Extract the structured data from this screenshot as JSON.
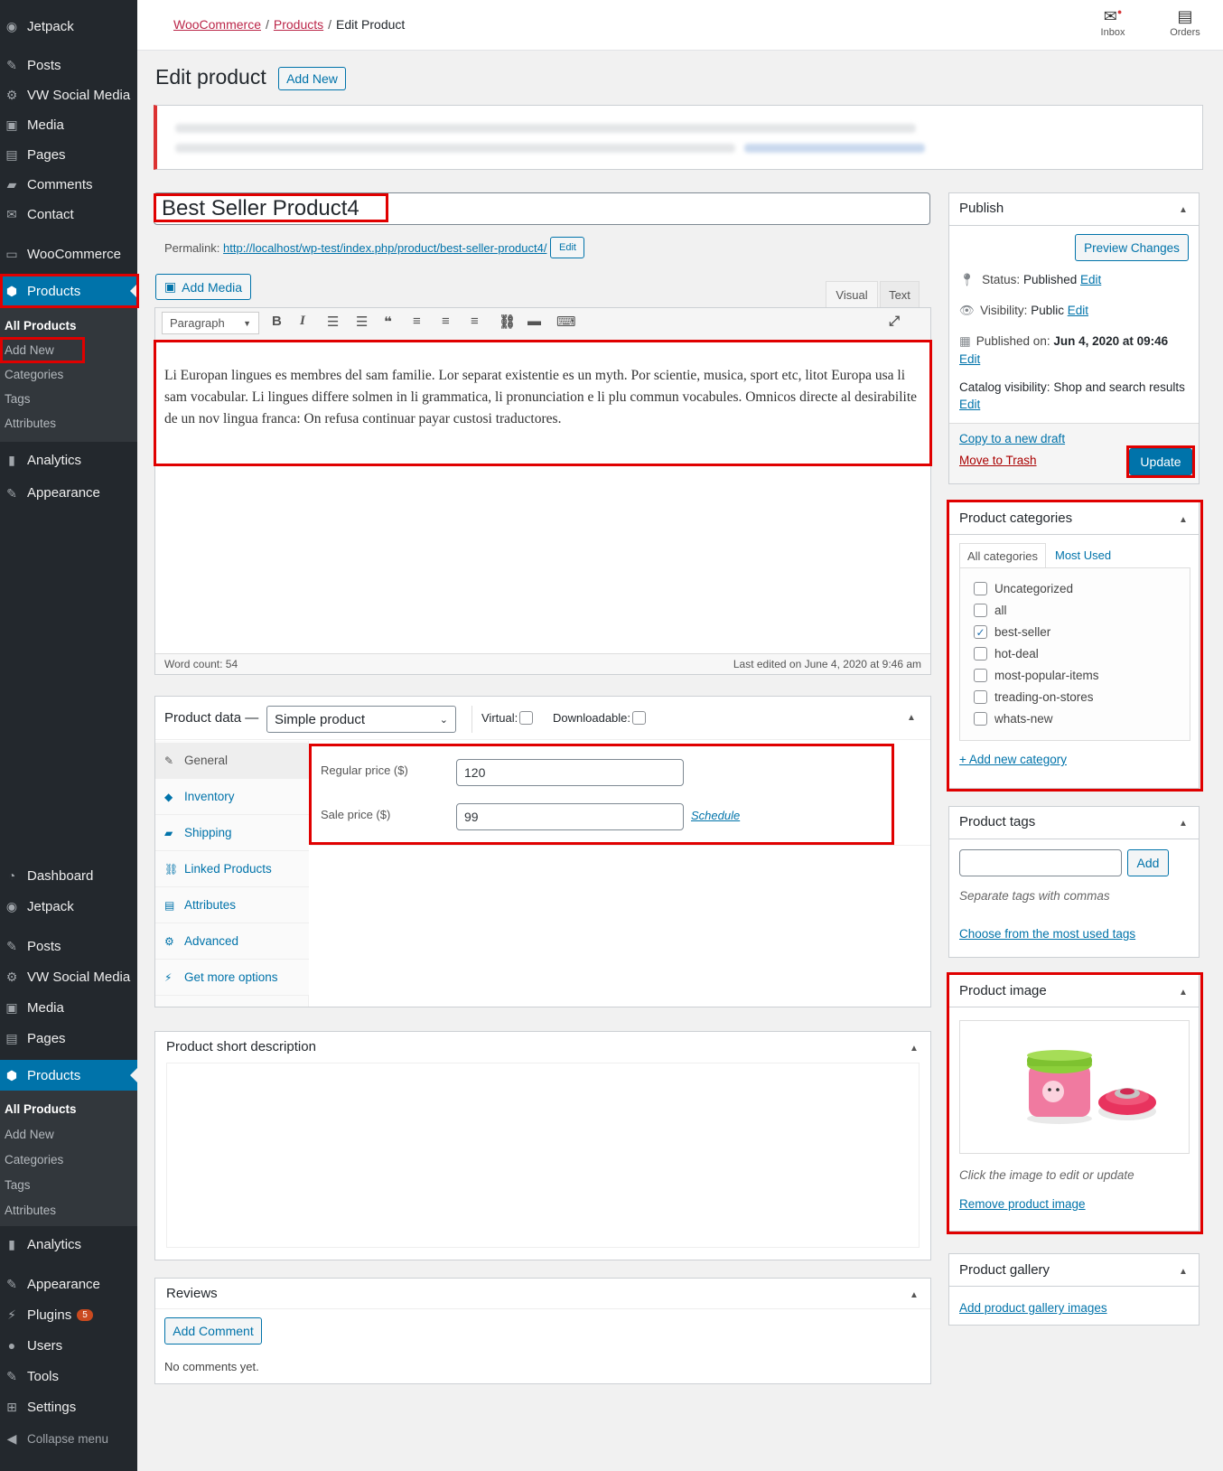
{
  "sidebar": {
    "top": {
      "jetpack": "Jetpack",
      "posts": "Posts",
      "vw_social": "VW Social Media",
      "media": "Media",
      "pages": "Pages",
      "comments": "Comments",
      "contact": "Contact",
      "woocommerce": "WooCommerce",
      "products": "Products",
      "sub_all": "All Products",
      "sub_add": "Add New",
      "sub_cat": "Categories",
      "sub_tags": "Tags",
      "sub_attr": "Attributes",
      "analytics": "Analytics",
      "appearance": "Appearance"
    },
    "bottom": {
      "dashboard": "Dashboard",
      "jetpack": "Jetpack",
      "posts": "Posts",
      "vw_social": "VW Social Media",
      "media": "Media",
      "pages": "Pages",
      "products": "Products",
      "sub_all": "All Products",
      "sub_add": "Add New",
      "sub_cat": "Categories",
      "sub_tags": "Tags",
      "sub_attr": "Attributes",
      "analytics": "Analytics",
      "appearance": "Appearance",
      "plugins": "Plugins",
      "plugins_badge": "5",
      "users": "Users",
      "tools": "Tools",
      "settings": "Settings",
      "collapse": "Collapse menu"
    }
  },
  "topbar": {
    "crumb_woo": "WooCommerce",
    "crumb_products": "Products",
    "crumb_current": "Edit Product",
    "sep": "/",
    "inbox": "Inbox",
    "orders": "Orders"
  },
  "header": {
    "title": "Edit product",
    "add_new": "Add New"
  },
  "post": {
    "title": "Best Seller Product4",
    "permalink_label": "Permalink:",
    "permalink_url": "http://localhost/wp-test/index.php/product/best-seller-product4/",
    "permalink_edit": "Edit"
  },
  "editor": {
    "add_media": "Add Media",
    "tab_visual": "Visual",
    "tab_text": "Text",
    "format": "Paragraph",
    "content": "Li Europan lingues es membres del sam familie. Lor separat existentie es un myth. Por scientie, musica, sport etc, litot Europa usa li sam vocabular. Li lingues differe solmen in li grammatica, li pronunciation e li plu commun vocabules. Omnicos directe al desirabilite de un nov lingua franca: On refusa continuar payar custosi traductores.",
    "word_count": "Word count: 54",
    "last_edited": "Last edited on June 4, 2020 at 9:46 am"
  },
  "product_data": {
    "label": "Product data —",
    "type": "Simple product",
    "virtual": "Virtual:",
    "downloadable": "Downloadable:",
    "tabs": [
      "General",
      "Inventory",
      "Shipping",
      "Linked Products",
      "Attributes",
      "Advanced",
      "Get more options"
    ],
    "regular_label": "Regular price ($)",
    "regular_value": "120",
    "sale_label": "Sale price ($)",
    "sale_value": "99",
    "schedule": "Schedule"
  },
  "short_desc": {
    "title": "Product short description"
  },
  "reviews": {
    "title": "Reviews",
    "add_comment": "Add Comment",
    "none": "No comments yet."
  },
  "publish": {
    "title": "Publish",
    "preview": "Preview Changes",
    "status_label": "Status:",
    "status_value": "Published",
    "status_edit": "Edit",
    "visibility_label": "Visibility:",
    "visibility_value": "Public",
    "visibility_edit": "Edit",
    "published_label": "Published on:",
    "published_value": "Jun 4, 2020 at 09:46",
    "published_edit": "Edit",
    "catalog_label": "Catalog visibility:",
    "catalog_value": "Shop and search results",
    "catalog_edit": "Edit",
    "copy_draft": "Copy to a new draft",
    "trash": "Move to Trash",
    "update": "Update"
  },
  "categories": {
    "title": "Product categories",
    "tab_all": "All categories",
    "tab_most": "Most Used",
    "items": [
      {
        "name": "Uncategorized",
        "checked": false
      },
      {
        "name": "all",
        "checked": false
      },
      {
        "name": "best-seller",
        "checked": true
      },
      {
        "name": "hot-deal",
        "checked": false
      },
      {
        "name": "most-popular-items",
        "checked": false
      },
      {
        "name": "treading-on-stores",
        "checked": false
      },
      {
        "name": "whats-new",
        "checked": false
      }
    ],
    "add_new": "+ Add new category"
  },
  "tags": {
    "title": "Product tags",
    "add": "Add",
    "hint": "Separate tags with commas",
    "choose": "Choose from the most used tags"
  },
  "image": {
    "title": "Product image",
    "hint": "Click the image to edit or update",
    "remove": "Remove product image"
  },
  "gallery": {
    "title": "Product gallery",
    "add": "Add product gallery images"
  },
  "colors": {
    "admin_bar": "#23282d",
    "accent": "#0073aa",
    "highlight": "#e00000"
  }
}
